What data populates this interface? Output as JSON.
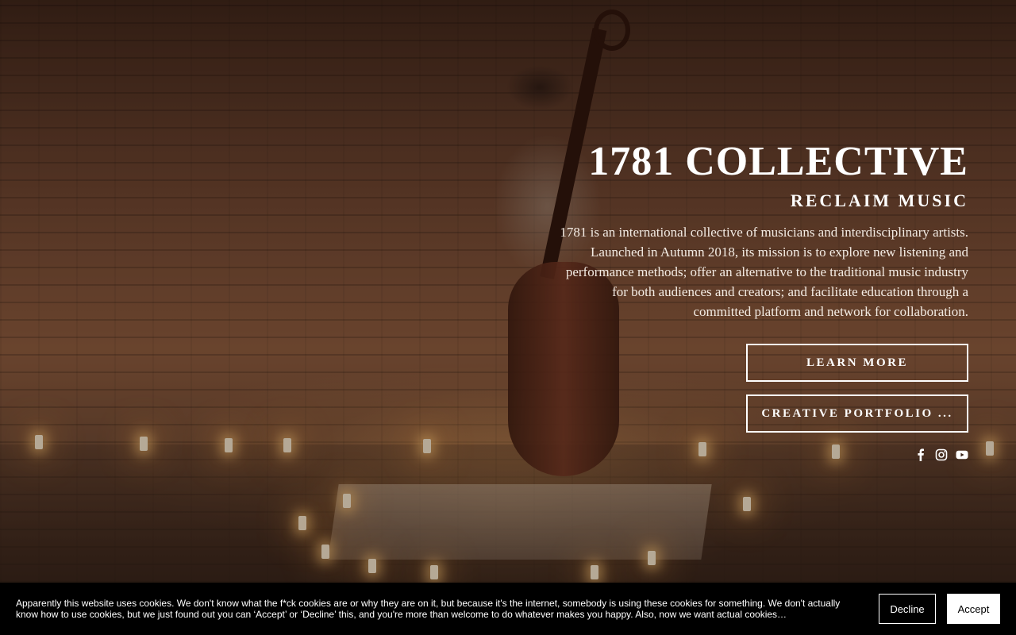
{
  "hero": {
    "title": "1781 COLLECTIVE",
    "tagline": "RECLAIM MUSIC",
    "description": "1781 is an international collective of musicians and interdisciplinary artists. Launched in Autumn 2018, its mission is to explore new listening and performance methods; offer an alternative to the traditional music industry for both audiences and creators; and facilitate education through a committed platform and network for collaboration.",
    "buttons": {
      "learn_more": "LEARN MORE",
      "portfolio": "CREATIVE PORTFOLIO ..."
    },
    "social_icons": [
      "facebook-icon",
      "instagram-icon",
      "youtube-icon"
    ]
  },
  "cookie_banner": {
    "text": "Apparently this website uses cookies. We don't know what the f*ck cookies are or why they are on it, but because it's the internet, somebody is using these cookies for something. We don't actually know how to use cookies, but we just found out you can ‘Accept’ or ‘Decline’ this, and you're more than welcome to do whatever makes you happy. Also, now we want actual cookies…",
    "decline_label": "Decline",
    "accept_label": "Accept"
  },
  "colors": {
    "text": "#ffffff",
    "banner_bg": "#000000",
    "accept_bg": "#ffffff"
  }
}
